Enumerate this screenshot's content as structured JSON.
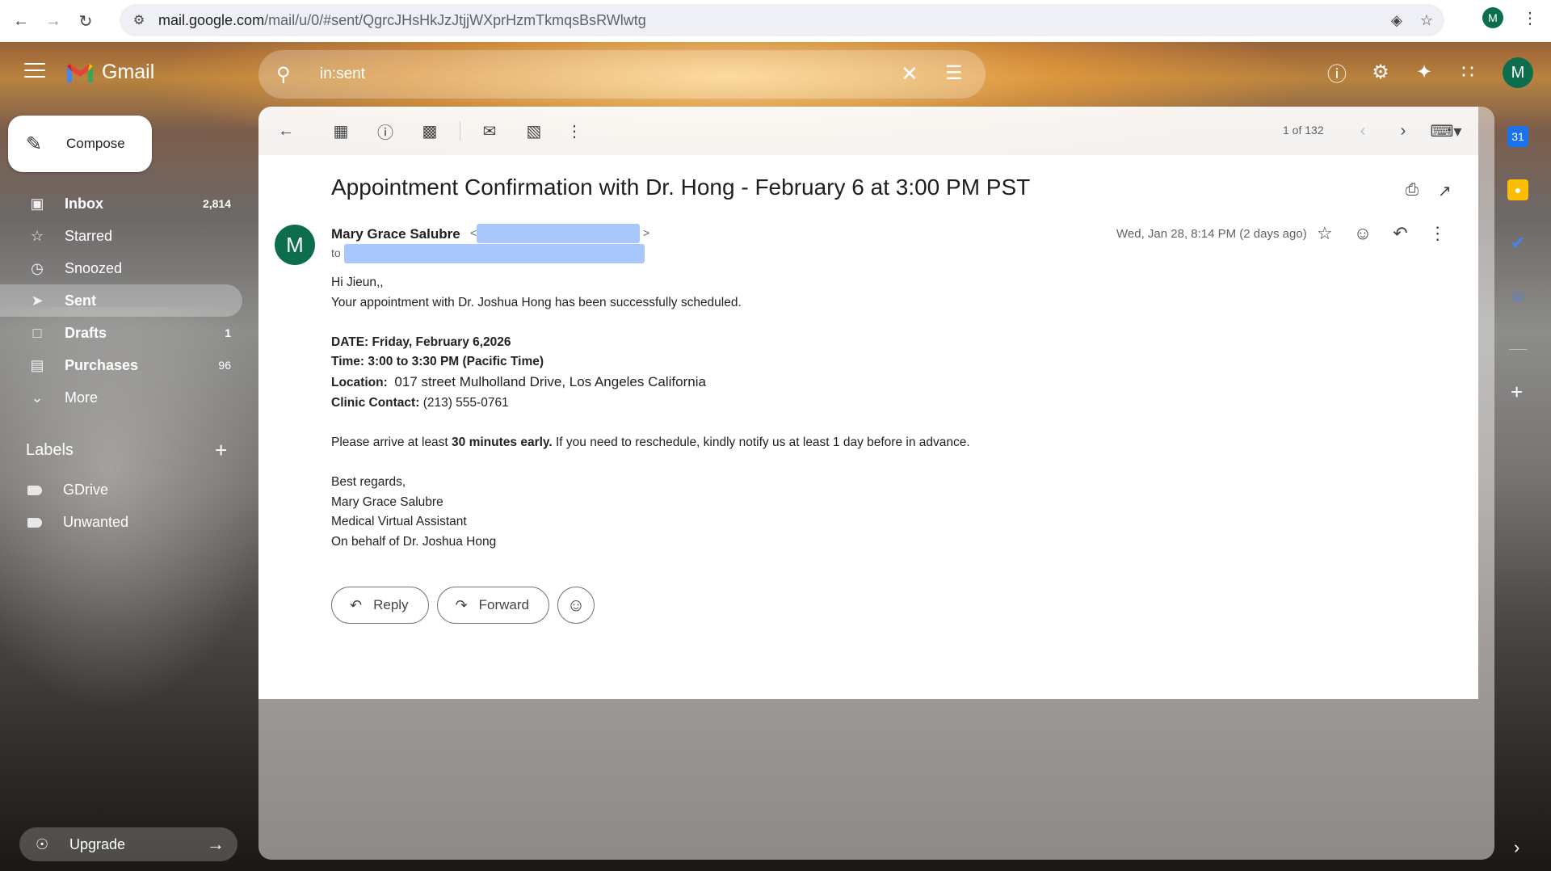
{
  "browser": {
    "url_host": "mail.google.com",
    "url_path": "/mail/u/0/#sent/QgrcJHsHkJzJtjjWXprHzmTkmqsBsRWlwtg",
    "profile_initial": "M"
  },
  "header": {
    "app_name": "Gmail",
    "search_value": "in:sent",
    "account_initial": "M"
  },
  "sidebar": {
    "compose_label": "Compose",
    "items": [
      {
        "label": "Inbox",
        "count": "2,814",
        "icon": "inbox-icon"
      },
      {
        "label": "Starred",
        "count": "",
        "icon": "star-icon"
      },
      {
        "label": "Snoozed",
        "count": "",
        "icon": "clock-icon"
      },
      {
        "label": "Sent",
        "count": "",
        "icon": "send-icon"
      },
      {
        "label": "Drafts",
        "count": "1",
        "icon": "draft-icon"
      },
      {
        "label": "Purchases",
        "count": "96",
        "icon": "shopping-bag-icon"
      },
      {
        "label": "More",
        "count": "",
        "icon": "chevron-down-icon"
      }
    ],
    "labels_heading": "Labels",
    "labels": [
      "GDrive",
      "Unwanted"
    ],
    "upgrade_label": "Upgrade"
  },
  "toolbar": {
    "pager": "1 of 132"
  },
  "email": {
    "subject": "Appointment Confirmation with Dr. Hong - February 6 at 3:00 PM PST",
    "sender_name": "Mary Grace Salubre",
    "to_label": "to",
    "date": "Wed, Jan 28, 8:14 PM (2 days ago)",
    "greeting": "Hi Jieun,,",
    "intro": "Your appointment with Dr. Joshua Hong has been successfully scheduled.",
    "date_line": "DATE: Friday, February 6,2026",
    "time_line": "Time: 3:00 to 3:30 PM (Pacific Time)",
    "location_label": "Location:",
    "location_value": "017 street Mulholland Drive, Los Angeles California",
    "contact_label": "Clinic Contact:",
    "contact_value": "(213) 555-0761",
    "arrive_pre": "Please arrive at least ",
    "arrive_bold": "30 minutes early.",
    "arrive_post": " If you need to reschedule, kindly notify us at least 1 day before in advance.",
    "signoff": "Best regards,",
    "sig_name": "Mary Grace Salubre",
    "sig_title": "Medical Virtual Assistant",
    "sig_behalf": "On behalf of Dr. Joshua Hong"
  },
  "actions": {
    "reply": "Reply",
    "forward": "Forward"
  },
  "colors": {
    "avatar": "#0d6e4e",
    "redaction": "#a8c7fa"
  }
}
